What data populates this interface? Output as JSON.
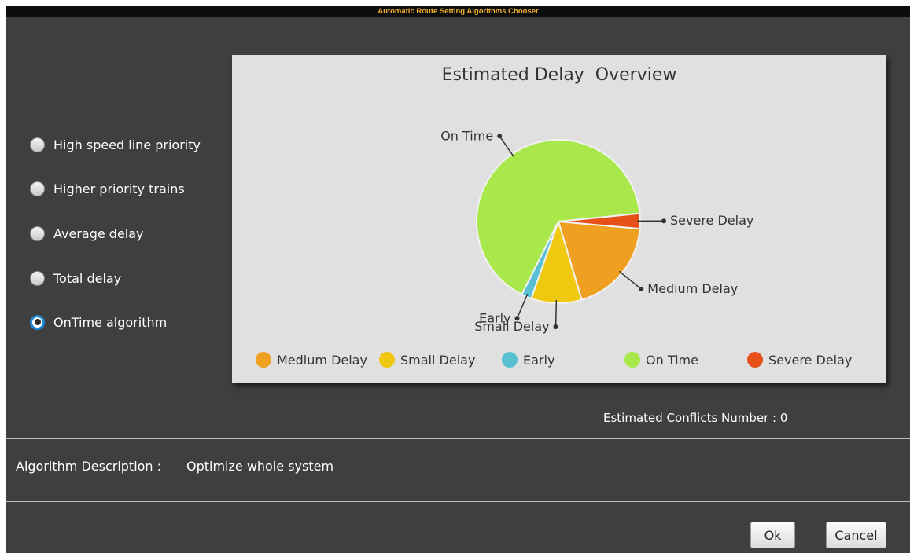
{
  "window": {
    "title": "Automatic Route Setting Algorithms Chooser"
  },
  "algorithms": {
    "options": [
      {
        "label": "High speed line priority",
        "selected": false
      },
      {
        "label": "Higher priority trains",
        "selected": false
      },
      {
        "label": "Average delay",
        "selected": false
      },
      {
        "label": "Total delay",
        "selected": false
      },
      {
        "label": "OnTime algorithm",
        "selected": true
      }
    ]
  },
  "chart_data": {
    "type": "pie",
    "title": "Estimated Delay  Overview",
    "legend_placement": "bottom",
    "slices": [
      {
        "label": "Severe Delay",
        "value": 3,
        "color": "#e8501a"
      },
      {
        "label": "Medium Delay",
        "value": 19,
        "color": "#f0a020"
      },
      {
        "label": "Small Delay",
        "value": 10,
        "color": "#f0c810"
      },
      {
        "label": "Early",
        "value": 2,
        "color": "#58c0d0"
      },
      {
        "label": "On Time",
        "value": 66,
        "color": "#a8e84a"
      }
    ],
    "legend": [
      {
        "label": "Medium Delay",
        "color": "#f0a020"
      },
      {
        "label": "Small Delay",
        "color": "#f0c810"
      },
      {
        "label": "Early",
        "color": "#58c0d0"
      },
      {
        "label": "On Time",
        "color": "#a8e84a"
      },
      {
        "label": "Severe Delay",
        "color": "#e8501a"
      }
    ]
  },
  "conflicts": {
    "text": "Estimated Conflicts Number : 0"
  },
  "description": {
    "label": "Algorithm Description :",
    "value": "Optimize whole system"
  },
  "buttons": {
    "ok": "Ok",
    "cancel": "Cancel"
  }
}
